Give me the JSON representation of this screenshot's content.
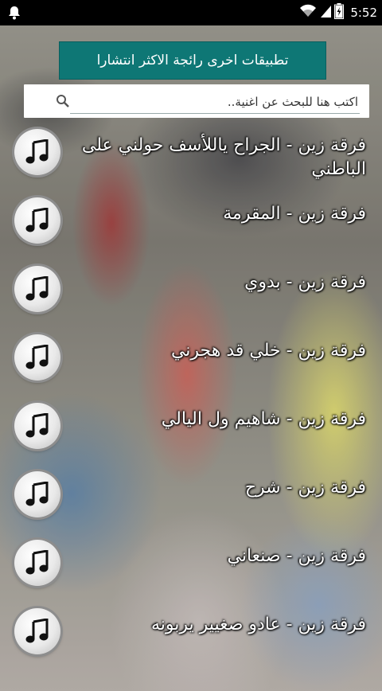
{
  "status_bar": {
    "time": "5:52"
  },
  "banner": {
    "label": "تطبيقات اخرى رائجة الاكثر انتشارا"
  },
  "search": {
    "placeholder": "اكتب هنا للبحث عن اغنية..",
    "value": ""
  },
  "songs": [
    {
      "title": "فرقة زين - الجراح ياللأسف حولني على الباطني"
    },
    {
      "title": "فرقة زين - المقرمة"
    },
    {
      "title": "فرقة زين - بدوي"
    },
    {
      "title": "فرقة زين - خلي قد هجرني"
    },
    {
      "title": "فرقة زين - شاهيم ول اليالي"
    },
    {
      "title": "فرقة زين - شرح"
    },
    {
      "title": "فرقة زين - صنعاني"
    },
    {
      "title": "فرقة زين - عادو صغيير يربونه"
    }
  ],
  "icons": {
    "notification": "bell-icon",
    "wifi": "wifi-icon",
    "signal": "signal-icon",
    "battery": "battery-icon",
    "search": "search-icon",
    "song": "music-note-icon"
  },
  "colors": {
    "banner": "#0e7775",
    "status_bar": "#000000",
    "text": "#ffffff"
  }
}
